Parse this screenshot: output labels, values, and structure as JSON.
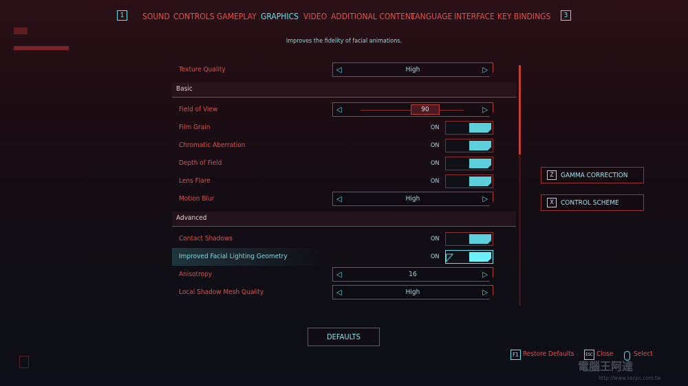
{
  "tabs": {
    "left_key": "1",
    "right_key": "3",
    "items": [
      {
        "label": "SOUND"
      },
      {
        "label": "CONTROLS"
      },
      {
        "label": "GAMEPLAY"
      },
      {
        "label": "GRAPHICS",
        "active": true
      },
      {
        "label": "VIDEO"
      },
      {
        "label": "ADDITIONAL CONTENT"
      },
      {
        "label": "LANGUAGE"
      },
      {
        "label": "INTERFACE"
      },
      {
        "label": "KEY BINDINGS"
      }
    ]
  },
  "description": "Improves the fidelity of facial animations.",
  "settings": {
    "texture_quality": {
      "label": "Texture Quality",
      "value": "High"
    },
    "basic_header": "Basic",
    "field_of_view": {
      "label": "Field of View",
      "value": "90",
      "slider_fraction": 0.6
    },
    "film_grain": {
      "label": "Film Grain",
      "value": "ON"
    },
    "chromatic_aberration": {
      "label": "Chromatic Aberration",
      "value": "ON"
    },
    "depth_of_field": {
      "label": "Depth of Field",
      "value": "ON"
    },
    "lens_flare": {
      "label": "Lens Flare",
      "value": "ON"
    },
    "motion_blur": {
      "label": "Motion Blur",
      "value": "High"
    },
    "advanced_header": "Advanced",
    "contact_shadows": {
      "label": "Contact Shadows",
      "value": "ON"
    },
    "facial_lighting": {
      "label": "Improved Facial Lighting Geometry",
      "value": "ON"
    },
    "anisotropy": {
      "label": "Anisotropy",
      "value": "16"
    },
    "local_shadow_mesh": {
      "label": "Local Shadow Mesh Quality",
      "value": "High"
    }
  },
  "side_buttons": [
    {
      "key": "Z",
      "label": "GAMMA CORRECTION"
    },
    {
      "key": "X",
      "label": "CONTROL SCHEME"
    }
  ],
  "defaults_label": "DEFAULTS",
  "hints": [
    {
      "key": "F1",
      "label": "Restore Defaults"
    },
    {
      "key": "ESC",
      "label": "Close"
    },
    {
      "key": "mouse",
      "label": "Select"
    }
  ],
  "colors": {
    "accent_red": "#e5504a",
    "accent_cyan": "#5ee7f0"
  },
  "watermark": {
    "text": "電腦王阿達",
    "url": "http://www.kocpc.com.tw"
  }
}
